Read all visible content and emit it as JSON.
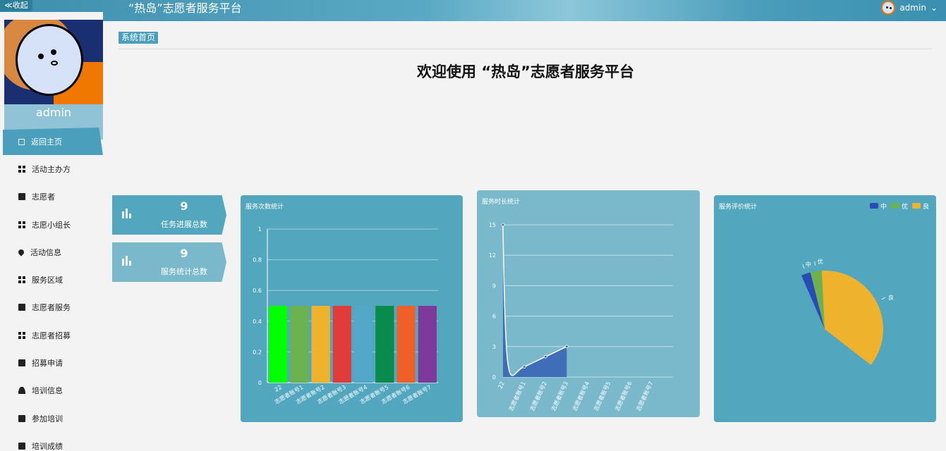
{
  "header": {
    "collapse_label": "≪收起",
    "title": "“热岛”志愿者服务平台",
    "user_name": "admin",
    "user_caret": "⌄"
  },
  "sidebar": {
    "profile_name": "admin",
    "items": [
      {
        "label": "返回主页",
        "icon": "home-icon"
      },
      {
        "label": "活动主办方",
        "icon": "grid-icon"
      },
      {
        "label": "志愿者",
        "icon": "chart-icon"
      },
      {
        "label": "志愿小组长",
        "icon": "grid-icon"
      },
      {
        "label": "活动信息",
        "icon": "pin-icon"
      },
      {
        "label": "服务区域",
        "icon": "grid-icon"
      },
      {
        "label": "志愿者服务",
        "icon": "ticket-icon"
      },
      {
        "label": "志愿者招募",
        "icon": "grid-icon"
      },
      {
        "label": "招募申请",
        "icon": "briefcase-icon"
      },
      {
        "label": "培训信息",
        "icon": "user-icon"
      },
      {
        "label": "参加培训",
        "icon": "comment-icon"
      },
      {
        "label": "培训成绩",
        "icon": "document-icon"
      }
    ]
  },
  "main": {
    "breadcrumb": "系统首页",
    "welcome": "欢迎使用 “热岛”志愿者服务平台",
    "stats": [
      {
        "value": "9",
        "label": "任务进展总数"
      },
      {
        "value": "9",
        "label": "服务统计总数"
      }
    ]
  },
  "chart_data": [
    {
      "type": "bar",
      "title": "服务次数统计",
      "categories": [
        "22",
        "志愿者账号1",
        "志愿者账号2",
        "志愿者账号3",
        "志愿者账号4",
        "志愿者账号5",
        "志愿者账号6",
        "志愿者账号7"
      ],
      "values": [
        0.5,
        0.5,
        0.5,
        0.5,
        0.5,
        0.5,
        0.5,
        0.5
      ],
      "colors": [
        "#00ff00",
        "#6cb24f",
        "#efb22c",
        "#e03c3c",
        "#53a8ca",
        "#098b4d",
        "#ef6028",
        "#7e3a99"
      ],
      "ylim": [
        0,
        1
      ],
      "yticks": [
        "0",
        "0.2",
        "0.4",
        "0.6",
        "0.8",
        "1"
      ],
      "grid": true
    },
    {
      "type": "area",
      "title": "服务时长统计",
      "categories": [
        "22",
        "志愿者账号1",
        "志愿者账号2",
        "志愿者账号3",
        "志愿者账号4",
        "志愿者账号5",
        "志愿者账号6",
        "志愿者账号7"
      ],
      "values": [
        15,
        1,
        2,
        3
      ],
      "ylim": [
        0,
        15
      ],
      "yticks": [
        "0",
        "3",
        "6",
        "9",
        "12",
        "15"
      ],
      "grid": true,
      "color": "#3f6db8"
    },
    {
      "type": "pie",
      "title": "服务评价统计",
      "legend": [
        {
          "name": "中",
          "color": "#2a4bb5"
        },
        {
          "name": "优",
          "color": "#6cb24f"
        },
        {
          "name": "良",
          "color": "#efb22c"
        }
      ],
      "slices": [
        {
          "name": "中",
          "value": 0.5,
          "color": "#2a4bb5"
        },
        {
          "name": "优",
          "value": 0.6,
          "color": "#6cb24f"
        },
        {
          "name": "良",
          "value": 7,
          "color": "#efb22c"
        }
      ],
      "legend_position": "top-right"
    }
  ]
}
